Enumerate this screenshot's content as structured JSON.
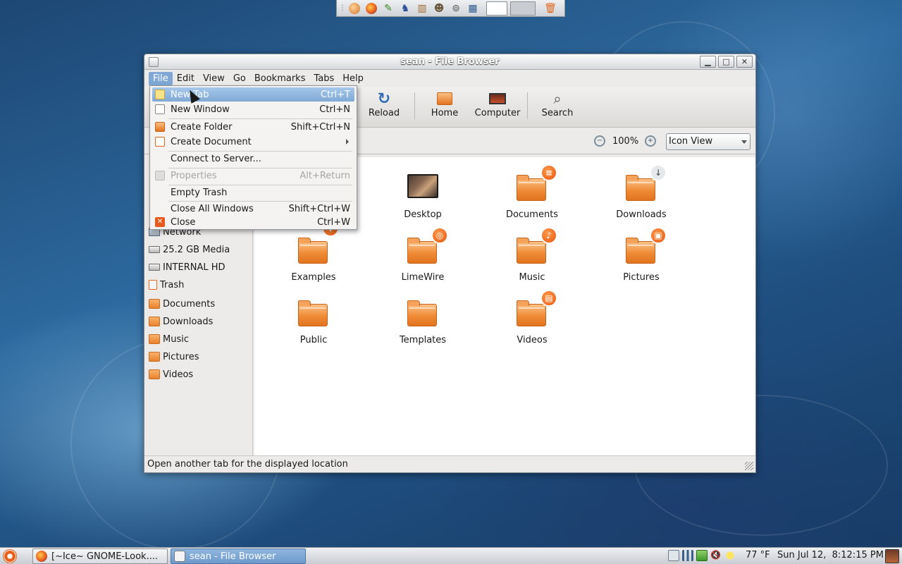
{
  "window": {
    "title": "sean - File Browser"
  },
  "menubar": {
    "items": [
      "File",
      "Edit",
      "View",
      "Go",
      "Bookmarks",
      "Tabs",
      "Help"
    ]
  },
  "toolbar": {
    "reload_label": "Reload",
    "home_label": "Home",
    "computer_label": "Computer",
    "search_label": "Search"
  },
  "location": {
    "zoom_level": "100%",
    "view_mode": "Icon View"
  },
  "file_menu": {
    "items": [
      {
        "label": "New Tab",
        "accel": "Ctrl+T",
        "highlighted": true
      },
      {
        "label": "New Window",
        "accel": "Ctrl+N"
      },
      {
        "label": "Create Folder",
        "accel": "Shift+Ctrl+N"
      },
      {
        "label": "Create Document",
        "accel": ""
      },
      {
        "label": "Connect to Server...",
        "accel": ""
      },
      {
        "label": "Properties",
        "accel": "Alt+Return",
        "disabled": true
      },
      {
        "label": "Empty Trash",
        "accel": ""
      },
      {
        "label": "Close All Windows",
        "accel": "Shift+Ctrl+W"
      },
      {
        "label": "Close",
        "accel": "Ctrl+W"
      }
    ]
  },
  "sidebar": {
    "items": [
      {
        "label": "Network",
        "icon": "network-icon"
      },
      {
        "label": "25.2 GB Media",
        "icon": "drive-icon"
      },
      {
        "label": "INTERNAL HD",
        "icon": "drive-icon"
      },
      {
        "label": "Trash",
        "icon": "trash-icon"
      },
      {
        "label": "Documents",
        "icon": "folder-icon"
      },
      {
        "label": "Downloads",
        "icon": "folder-icon"
      },
      {
        "label": "Music",
        "icon": "folder-icon"
      },
      {
        "label": "Pictures",
        "icon": "folder-icon"
      },
      {
        "label": "Videos",
        "icon": "folder-icon"
      }
    ]
  },
  "files": [
    {
      "label": "Desktop",
      "icon": "desktop-folder-icon"
    },
    {
      "label": "Documents",
      "icon": "documents-folder-icon"
    },
    {
      "label": "Downloads",
      "icon": "downloads-folder-icon"
    },
    {
      "label": "Examples",
      "icon": "examples-folder-icon"
    },
    {
      "label": "LimeWire",
      "icon": "limewire-folder-icon"
    },
    {
      "label": "Music",
      "icon": "music-folder-icon"
    },
    {
      "label": "Pictures",
      "icon": "pictures-folder-icon"
    },
    {
      "label": "Public",
      "icon": "public-folder-icon"
    },
    {
      "label": "Templates",
      "icon": "templates-folder-icon"
    },
    {
      "label": "Videos",
      "icon": "videos-folder-icon"
    }
  ],
  "status": {
    "text": "Open another tab for the displayed location"
  },
  "taskbar": {
    "tasks": [
      {
        "label": "[~Ice~ GNOME-Look....",
        "active": false
      },
      {
        "label": "sean - File Browser",
        "active": true
      }
    ],
    "weather": "77 °F",
    "clock": "Sun Jul 12,  8:12:15 PM"
  },
  "colors": {
    "accent": "#7fa9d6",
    "folder_orange": "#ef8a35",
    "emblem_orange": "#e8550f"
  }
}
